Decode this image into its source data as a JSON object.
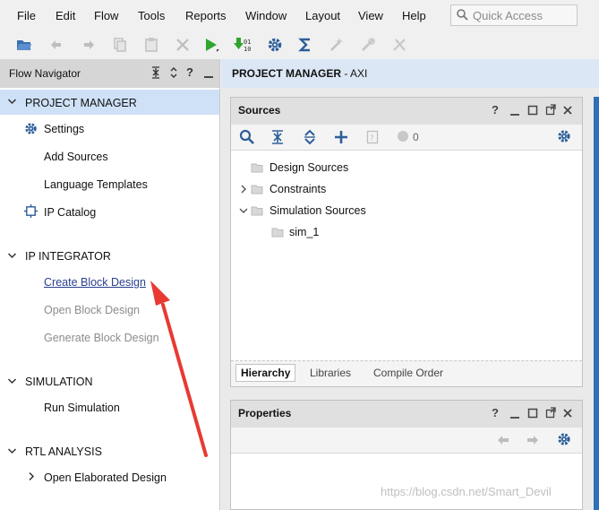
{
  "menubar": {
    "items": [
      {
        "label": "File"
      },
      {
        "label": "Edit"
      },
      {
        "label": "Flow"
      },
      {
        "label": "Tools"
      },
      {
        "label": "Reports"
      },
      {
        "label": "Window"
      },
      {
        "label": "Layout"
      },
      {
        "label": "View"
      },
      {
        "label": "Help"
      }
    ],
    "quick_access_placeholder": "Quick Access"
  },
  "toolbar": {
    "icons": [
      "open-project-icon",
      "undo-icon",
      "redo-icon",
      "copy-icon",
      "paste-icon",
      "delete-icon",
      "run-icon",
      "generate-bitstream-icon",
      "settings-icon",
      "sigma-icon",
      "wand-icon",
      "tool-disabled-icon",
      "cross-tool-icon"
    ]
  },
  "flow_navigator": {
    "title": "Flow Navigator",
    "sections": [
      {
        "title": "PROJECT MANAGER",
        "items": [
          "Settings",
          "Add Sources",
          "Language Templates",
          "IP Catalog"
        ]
      },
      {
        "title": "IP INTEGRATOR",
        "items": [
          "Create Block Design",
          "Open Block Design",
          "Generate Block Design"
        ]
      },
      {
        "title": "SIMULATION",
        "items": [
          "Run Simulation"
        ]
      },
      {
        "title": "RTL ANALYSIS",
        "items": [
          "Open Elaborated Design"
        ]
      }
    ]
  },
  "project_manager": {
    "title": "PROJECT MANAGER",
    "project": " - AXI"
  },
  "sources": {
    "title": "Sources",
    "count": "0",
    "tree": [
      "Design Sources",
      "Constraints",
      "Simulation Sources",
      "sim_1"
    ],
    "tabs": [
      "Hierarchy",
      "Libraries",
      "Compile Order"
    ]
  },
  "properties": {
    "title": "Properties"
  },
  "watermark": "https://blog.csdn.net/Smart_Devil",
  "colors": {
    "selection": "#cfe1f7",
    "run_green": "#2fa52f",
    "link": "#2a3f8f",
    "arrow": "#e83a33"
  }
}
